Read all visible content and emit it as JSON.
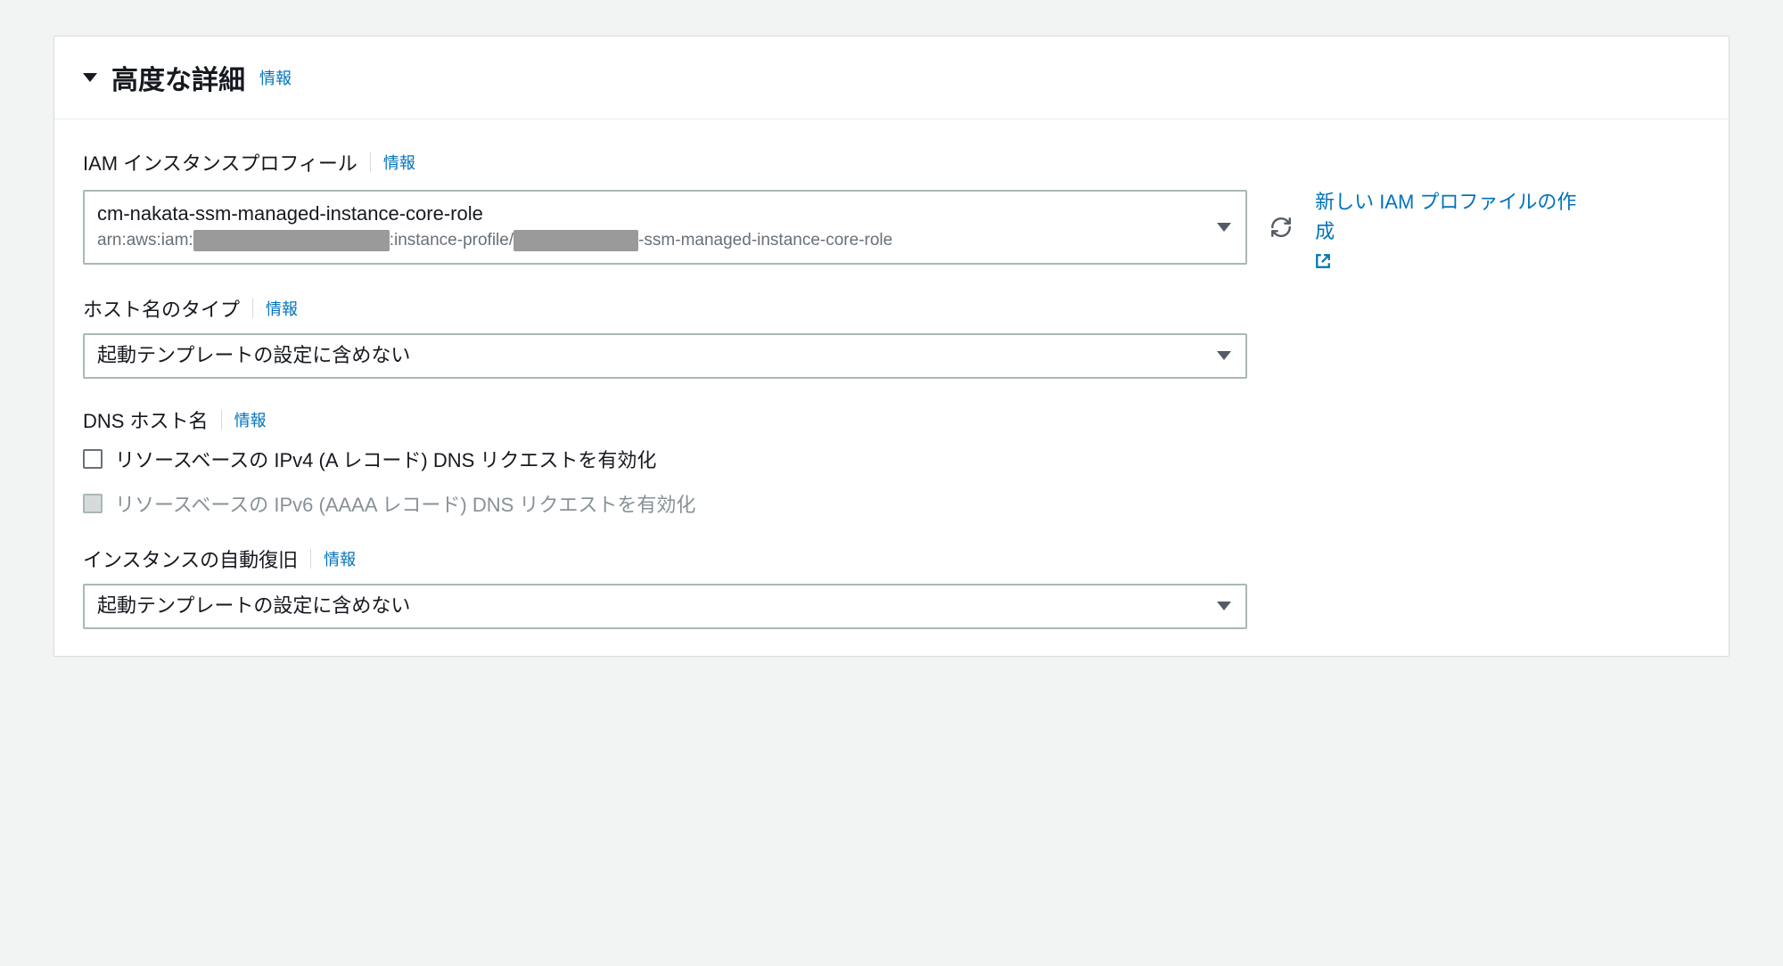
{
  "panel": {
    "title": "高度な詳細",
    "info": "情報"
  },
  "iam": {
    "label": "IAM インスタンスプロフィール",
    "info": "情報",
    "selectedName": "cm-nakata-ssm-managed-instance-core-role",
    "arnPrefix": "arn:aws:iam:",
    "arnMid": ":instance-profile/",
    "arnSuffix": "-ssm-managed-instance-core-role",
    "createLink": "新しい IAM プロファイルの作成"
  },
  "hostname": {
    "label": "ホスト名のタイプ",
    "info": "情報",
    "selected": "起動テンプレートの設定に含めない"
  },
  "dns": {
    "label": "DNS ホスト名",
    "info": "情報",
    "ipv4Label": "リソースベースの IPv4 (A レコード) DNS リクエストを有効化",
    "ipv6Label": "リソースベースの IPv6 (AAAA レコード) DNS リクエストを有効化"
  },
  "autoRecovery": {
    "label": "インスタンスの自動復旧",
    "info": "情報",
    "selected": "起動テンプレートの設定に含めない"
  }
}
